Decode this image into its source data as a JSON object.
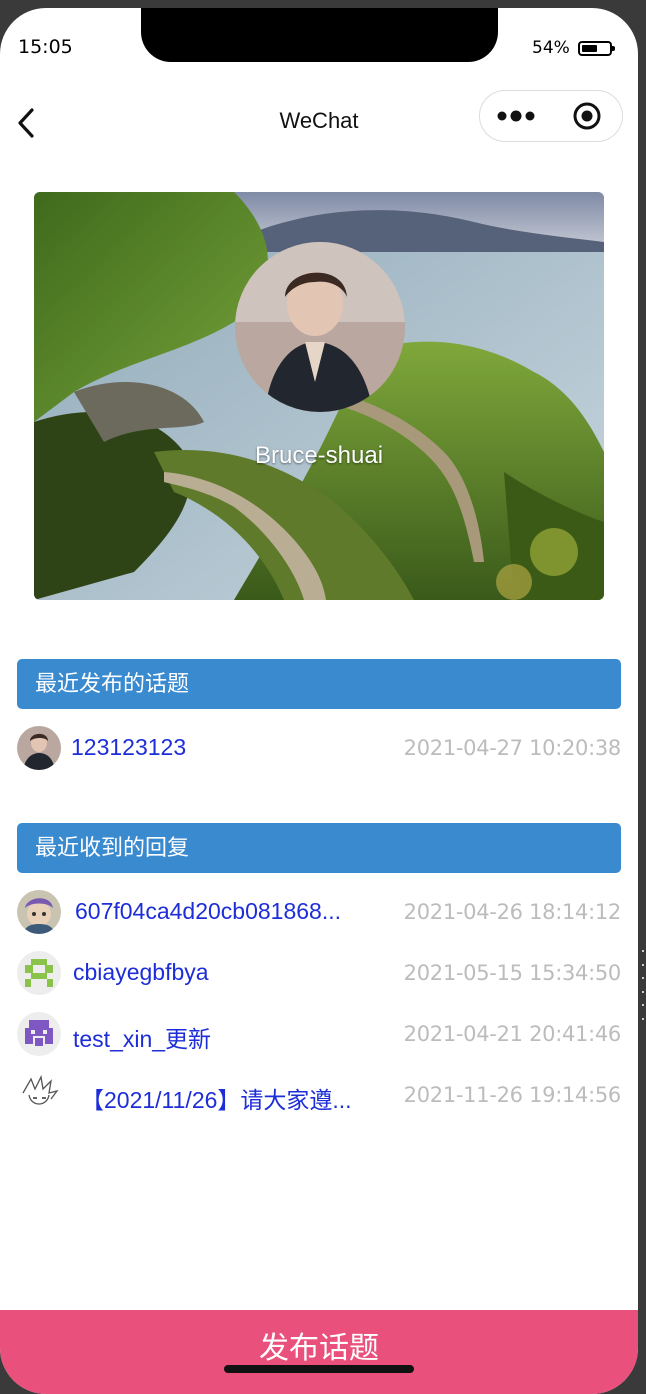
{
  "status": {
    "time": "15:05",
    "battery": "54%"
  },
  "nav": {
    "title": "WeChat"
  },
  "profile": {
    "name": "Bruce-shuai"
  },
  "recent_topics": {
    "header": "最近发布的话题",
    "items": [
      {
        "title": "123123123",
        "time": "2021-04-27 10:20:38"
      }
    ]
  },
  "recent_replies": {
    "header": "最近收到的回复",
    "items": [
      {
        "title": "607f04ca4d20cb081868...",
        "time": "2021-04-26 18:14:12",
        "avatar": "cartoon-avatar"
      },
      {
        "title": "cbiayegbfbya",
        "time": "2021-05-15 15:34:50",
        "avatar": "green-pixel-avatar"
      },
      {
        "title": "test_xin_更新",
        "time": "2021-04-21 20:41:46",
        "avatar": "purple-pixel-avatar"
      },
      {
        "title": "【2021/11/26】请大家遵...",
        "time": "2021-11-26 19:14:56",
        "avatar": "sketch-avatar"
      }
    ]
  },
  "publish_button": {
    "label": "发布话题"
  },
  "colors": {
    "accent": "#3a8ad0",
    "publish": "#e9507b",
    "link": "#1d2ed8",
    "time": "#bcbcbc"
  }
}
